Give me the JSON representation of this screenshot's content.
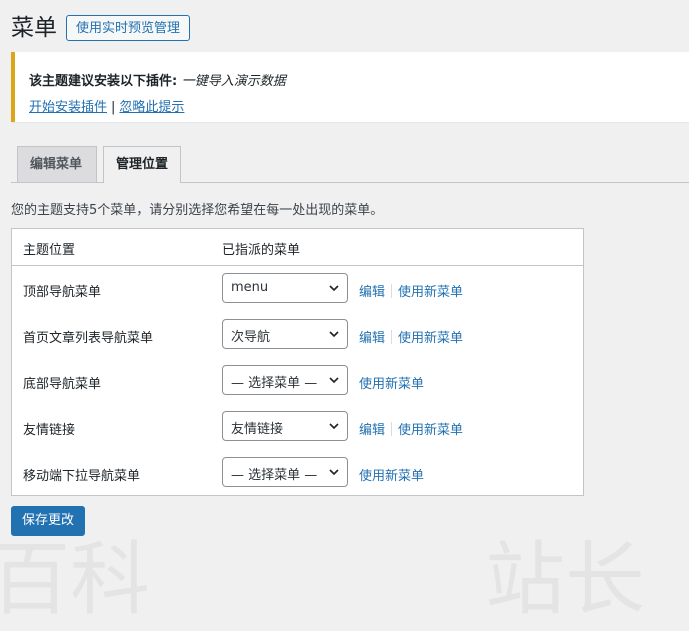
{
  "header": {
    "title": "菜单",
    "live_preview_button": "使用实时预览管理"
  },
  "notice": {
    "message_prefix": "该主题建议安装以下插件:",
    "plugin_name": "一键导入演示数据",
    "install_link": "开始安装插件",
    "separator": "|",
    "dismiss_link": "忽略此提示",
    "border_color": "#dba617"
  },
  "tabs": [
    {
      "label": "编辑菜单",
      "active": false
    },
    {
      "label": "管理位置",
      "active": true
    }
  ],
  "description": "您的主题支持5个菜单，请分别选择您希望在每一处出现的菜单。",
  "table": {
    "headers": [
      "主题位置",
      "已指派的菜单"
    ],
    "rows": [
      {
        "location": "顶部导航菜单",
        "selected": "menu",
        "edit": "编辑",
        "new": "使用新菜单"
      },
      {
        "location": "首页文章列表导航菜单",
        "selected": "次导航",
        "edit": "编辑",
        "new": "使用新菜单"
      },
      {
        "location": "底部导航菜单",
        "selected": "— 选择菜单 —",
        "edit": "",
        "new": "使用新菜单"
      },
      {
        "location": "友情链接",
        "selected": "友情链接",
        "edit": "编辑",
        "new": "使用新菜单"
      },
      {
        "location": "移动端下拉导航菜单",
        "selected": "— 选择菜单 —",
        "edit": "",
        "new": "使用新菜单"
      }
    ]
  },
  "save_button": "保存更改",
  "colors": {
    "accent": "#2271b1",
    "background": "#f0f0f1"
  }
}
